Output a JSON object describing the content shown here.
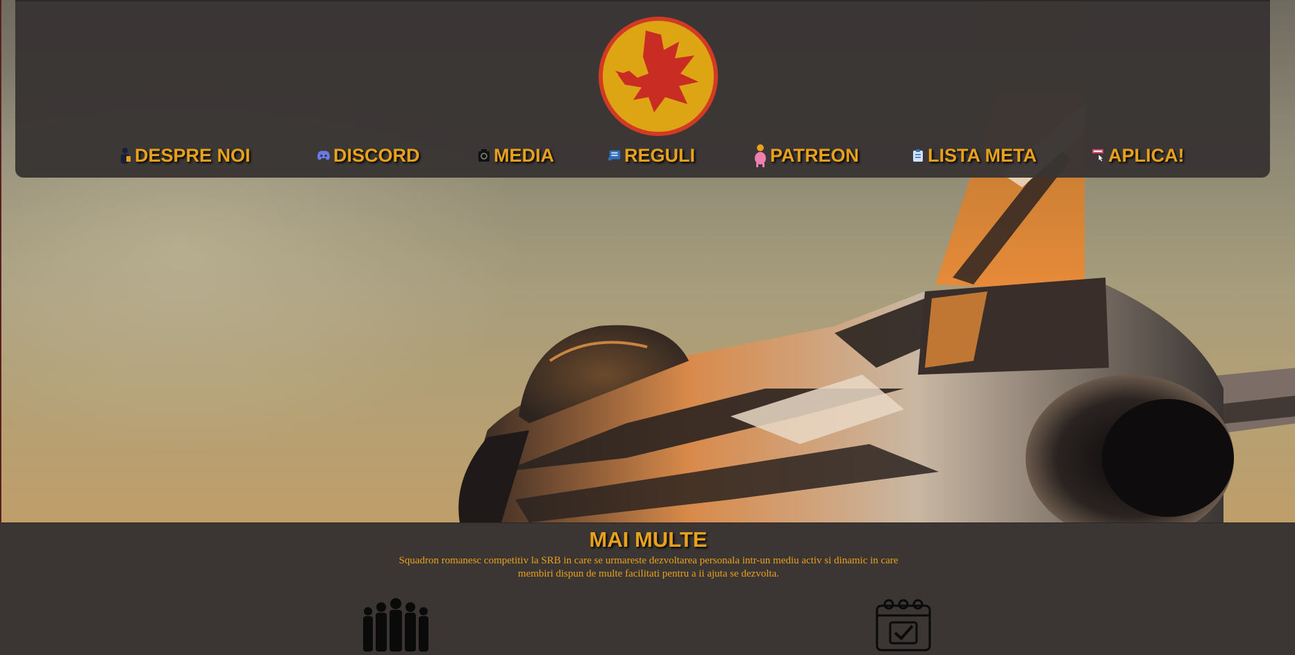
{
  "header": {
    "logo_name": "eagle-emblem-logo",
    "nav": [
      {
        "label": "DESPRE NOI",
        "icon": "person-icon"
      },
      {
        "label": "DISCORD",
        "icon": "discord-icon"
      },
      {
        "label": "MEDIA",
        "icon": "camera-icon"
      },
      {
        "label": "REGULI",
        "icon": "scroll-icon"
      },
      {
        "label": "PATREON",
        "icon": "piggy-bank-icon"
      },
      {
        "label": "LISTA META",
        "icon": "clipboard-icon"
      },
      {
        "label": "APLICA!",
        "icon": "apply-pointer-icon"
      }
    ]
  },
  "colors": {
    "accent": "#e8a11c",
    "panel": "#383433",
    "logo_red": "#d23a24",
    "logo_yellow": "#e5ad14"
  },
  "more": {
    "title": "MAI MULTE",
    "description_line1": "Squadron romanesc competitiv la SRB in care se urmareste dezvoltarea personala intr-un mediu activ si dinamic in care",
    "description_line2": "membiri dispun de multe facilitati pentru a ii ajuta se dezvolta.",
    "features": [
      {
        "icon": "team-group-icon"
      },
      {
        "icon": "calendar-check-icon"
      }
    ]
  }
}
